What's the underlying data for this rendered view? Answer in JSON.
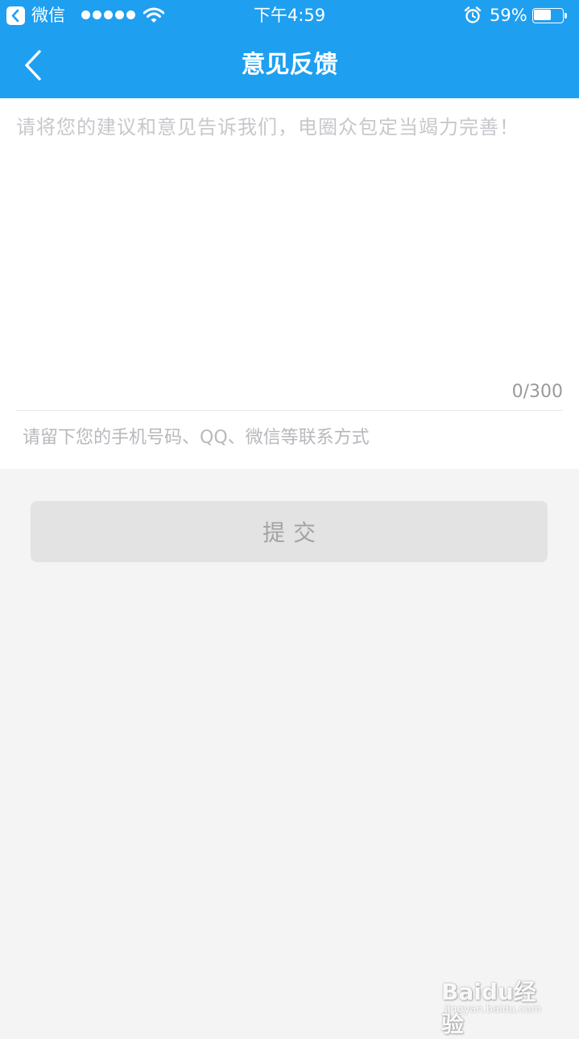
{
  "status_bar": {
    "app_name": "微信",
    "time": "下午4:59",
    "battery_percent": "59%",
    "battery_level": 0.59,
    "signal_dots": 5,
    "icons": [
      "back-to-app-icon",
      "signal-dots-icon",
      "wifi-icon",
      "alarm-icon",
      "battery-icon"
    ]
  },
  "nav": {
    "title": "意见反馈",
    "back_icon": "chevron-left-icon"
  },
  "form": {
    "feedback_placeholder": "请将您的建议和意见告诉我们，电圈众包定当竭力完善！",
    "feedback_value": "",
    "char_count": "0/300",
    "contact_placeholder": "请留下您的手机号码、QQ、微信等联系方式",
    "contact_value": ""
  },
  "actions": {
    "submit_label": "提交"
  },
  "watermark": {
    "logo": "Baidu经验",
    "url": "jingyan.baidu.com"
  },
  "colors": {
    "primary": "#1f9ff0",
    "background": "#f4f4f4",
    "button_disabled": "#e3e3e3",
    "placeholder": "#c7c7cc"
  }
}
